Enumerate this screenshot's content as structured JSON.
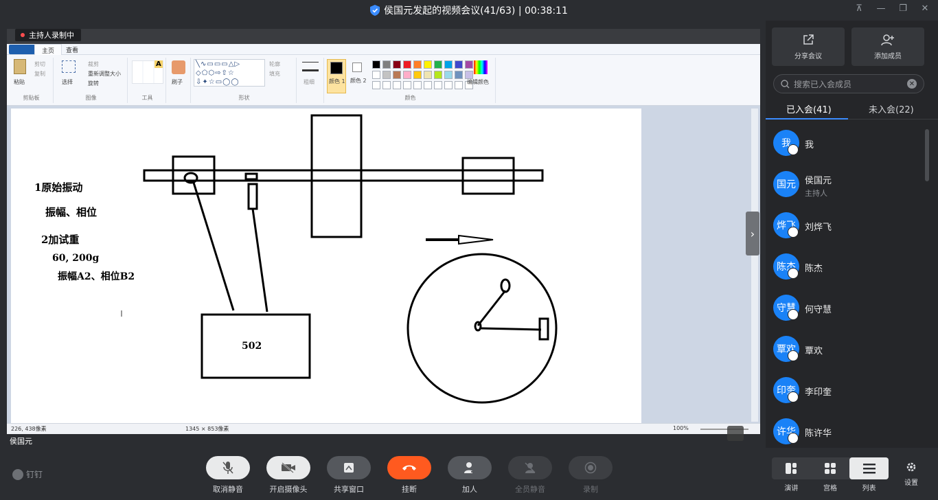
{
  "window": {
    "title": "侯国元发起的视频会议(41/63) | 00:38:11",
    "controls": [
      "pin",
      "minimize",
      "restore",
      "close"
    ]
  },
  "recording_badge": "主持人录制中",
  "paint": {
    "tabs": {
      "home": "主页",
      "view": "查看"
    },
    "clipboard": {
      "paste": "粘贴",
      "cut": "剪切",
      "copy": "复制",
      "group": "剪贴板"
    },
    "image": {
      "select": "选择",
      "crop": "裁剪",
      "resize": "重新调整大小",
      "rotate": "旋转",
      "group": "图像"
    },
    "tools": {
      "group": "工具"
    },
    "brush": {
      "label": "刷子"
    },
    "shapes": {
      "outline": "轮廓",
      "fill": "填充",
      "group": "形状"
    },
    "size": {
      "label": "粗细"
    },
    "colors": {
      "color1": "颜色 1",
      "color2": "颜色 2",
      "edit": "编辑颜色",
      "group": "颜色"
    },
    "palette": [
      "#000000",
      "#7f7f7f",
      "#880015",
      "#ed1c24",
      "#ff7f27",
      "#fff200",
      "#22b14c",
      "#00a2e8",
      "#3f48cc",
      "#a349a4",
      "#ffffff",
      "#c3c3c3",
      "#b97a57",
      "#ffaec9",
      "#ffc90e",
      "#efe4b0",
      "#b5e61d",
      "#99d9ea",
      "#7092be",
      "#c8bfe7"
    ],
    "canvas_text": {
      "t1": "1原始振动",
      "t2": "振幅、相位",
      "t3": "2加试重",
      "t4": "60, 200g",
      "t5": "振幅A2、相位B2",
      "box_label": "502"
    },
    "status": {
      "cursor": "226, 438像素",
      "size": "1345 × 853像素",
      "zoom": "100%"
    }
  },
  "speaker_name": "侯国元",
  "panel": {
    "share": "分享会议",
    "add_member": "添加成员",
    "search_placeholder": "搜索已入会成员",
    "tab_joined": "已入会(41)",
    "tab_not_joined": "未入会(22)",
    "members": [
      {
        "avatar": "我",
        "name": "我",
        "role": "",
        "muted": true
      },
      {
        "avatar": "国元",
        "name": "侯国元",
        "role": "主持人",
        "muted": false
      },
      {
        "avatar": "烨飞",
        "name": "刘烨飞",
        "role": "",
        "muted": true
      },
      {
        "avatar": "陈杰",
        "name": "陈杰",
        "role": "",
        "muted": true
      },
      {
        "avatar": "守慧",
        "name": "何守慧",
        "role": "",
        "muted": true
      },
      {
        "avatar": "覃欢",
        "name": "覃欢",
        "role": "",
        "muted": true
      },
      {
        "avatar": "印奎",
        "name": "李印奎",
        "role": "",
        "muted": true
      },
      {
        "avatar": "许华",
        "name": "陈许华",
        "role": "",
        "muted": true
      }
    ]
  },
  "toolbar": {
    "brand": "钉钉",
    "unmute": "取消静音",
    "camera": "开启摄像头",
    "share_window": "共享窗口",
    "hangup": "挂断",
    "add_person": "加人",
    "mute_all": "全员静音",
    "record": "录制",
    "layout_speaker": "演讲",
    "layout_grid": "宫格",
    "layout_list": "列表",
    "settings": "设置"
  }
}
